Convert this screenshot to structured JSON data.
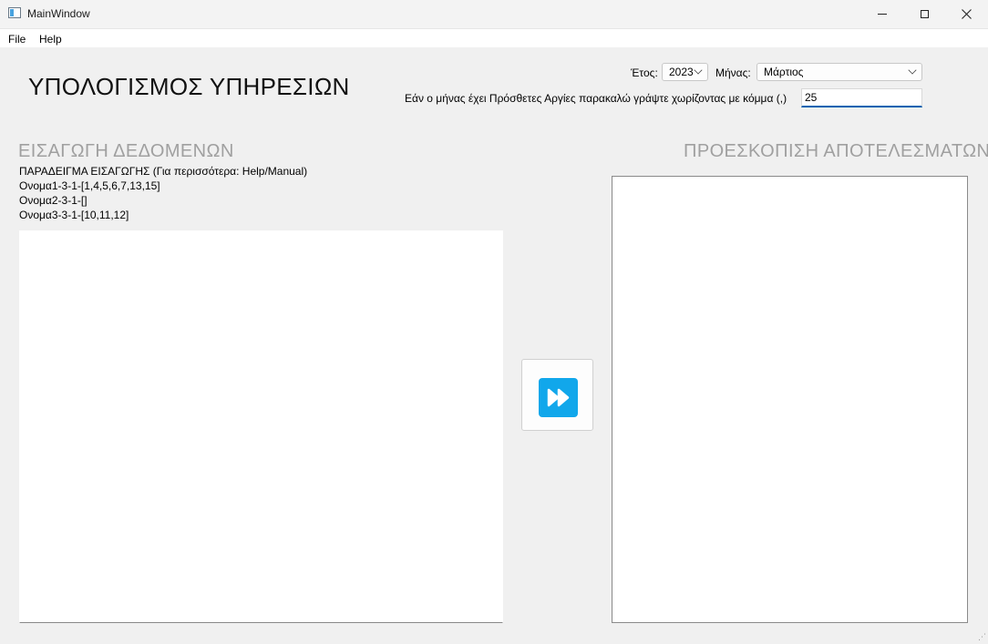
{
  "window": {
    "title": "MainWindow"
  },
  "menu": {
    "items": [
      "File",
      "Help"
    ]
  },
  "header": {
    "title": "ΥΠΟΛΟΓΙΣΜΟΣ ΥΠΗΡΕΣΙΩΝ"
  },
  "controls": {
    "year_label": "Έτος:",
    "year_value": "2023",
    "month_label": "Μήνας:",
    "month_value": "Μάρτιος",
    "holidays_label": "Εάν ο μήνας έχει Πρόσθετες Αργίες παρακαλώ γράψτε χωρίζοντας με κόμμα (,)",
    "holidays_value": "25"
  },
  "input_section": {
    "title": "ΕΙΣΑΓΩΓΗ ΔΕΔΟΜΕΝΩΝ",
    "example_lines": [
      "ΠΑΡΑΔΕΙΓΜΑ ΕΙΣΑΓΩΓΗΣ (Για περισσότερα: Help/Manual)",
      "Ονομα1-3-1-[1,4,5,6,7,13,15]",
      "Ονομα2-3-1-[]",
      "Ονομα3-3-1-[10,11,12]"
    ]
  },
  "output_section": {
    "title": "ΠΡΟΕΣΚΟΠΙΣΗ ΑΠΟΤΕΛΕΣΜΑΤΩΝ"
  },
  "icons": {
    "run": "fast-forward-icon",
    "app": "window-app-icon"
  },
  "colors": {
    "accent": "#11a7eb",
    "focus_underline": "#0063b1",
    "section_title": "#a0a0a0"
  }
}
